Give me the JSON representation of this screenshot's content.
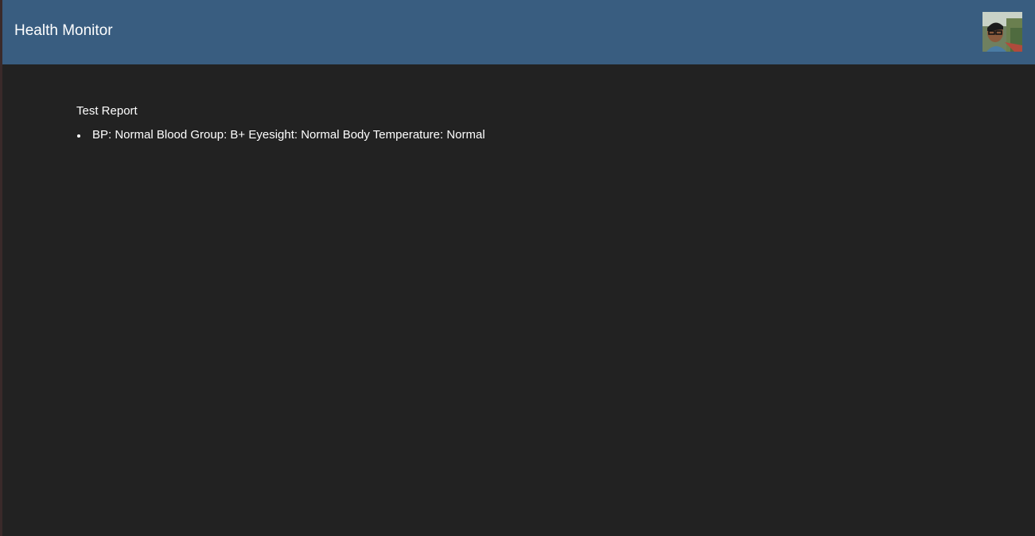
{
  "header": {
    "title": "Health Monitor",
    "background_color": "#395d80",
    "avatar_icon": "user-profile-photo"
  },
  "main": {
    "background_color": "#222222",
    "section_title": "Test Report",
    "report_items": [
      "BP: Normal Blood Group: B+ Eyesight: Normal Body Temperature: Normal"
    ]
  }
}
